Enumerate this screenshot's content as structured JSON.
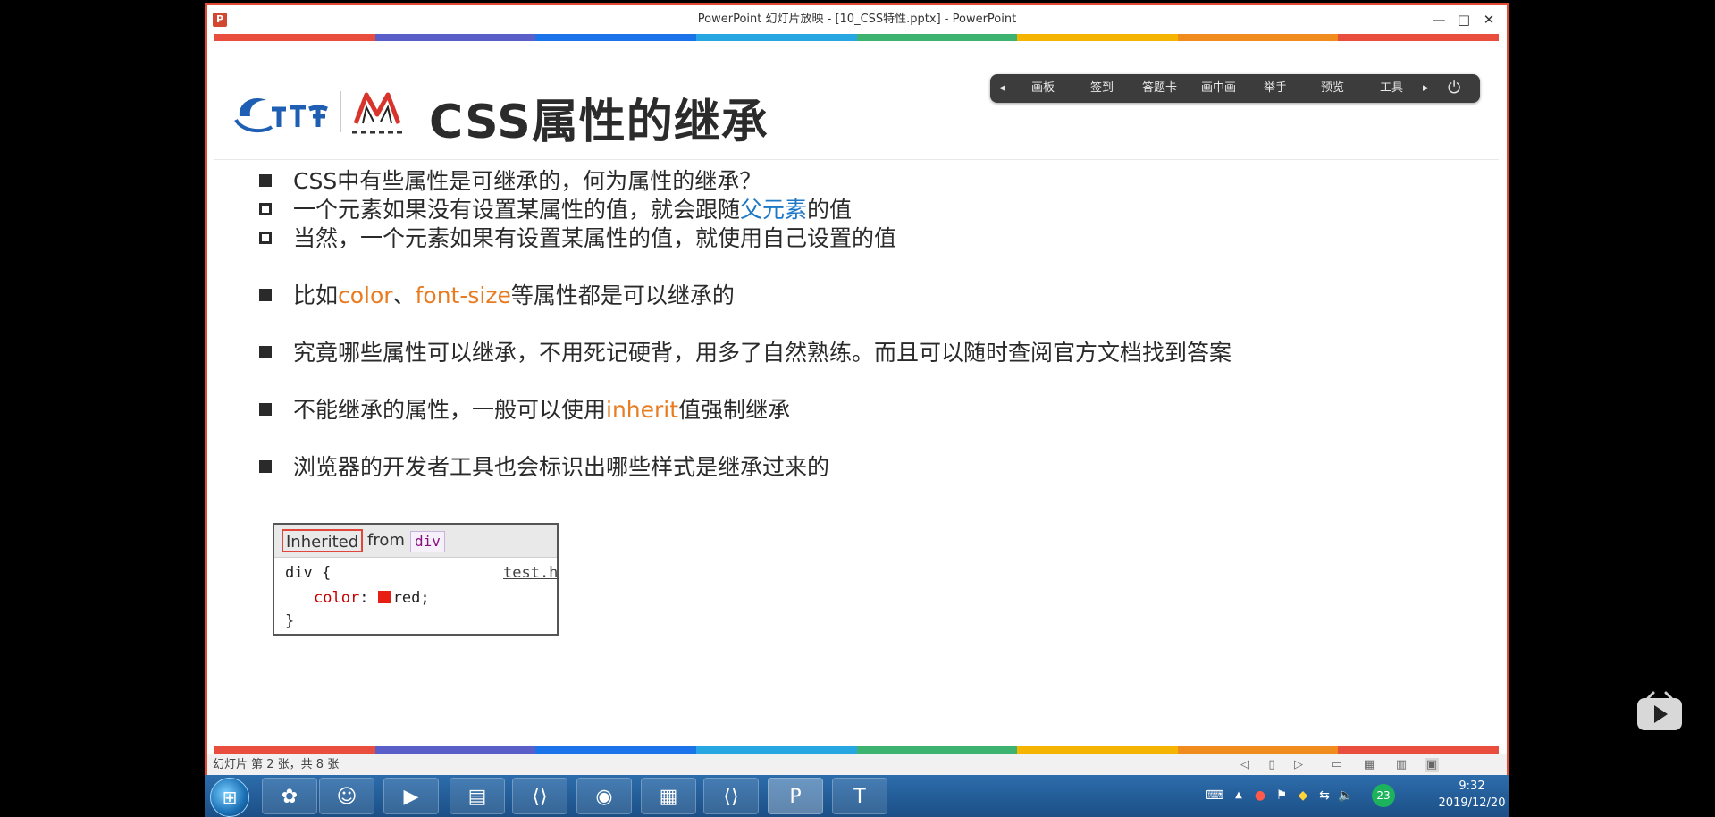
{
  "window": {
    "title": "PowerPoint 幻灯片放映 - [10_CSS特性.pptx] - PowerPoint",
    "app_icon": "P",
    "minimize": "—",
    "maximize": "□",
    "close": "✕"
  },
  "slide": {
    "title": "CSS属性的继承",
    "stripe_colors": [
      "#e84d3d",
      "#5a5ec8",
      "#1a73e8",
      "#27a7e2",
      "#3cb371",
      "#f4b400",
      "#f08c1e",
      "#e84d3d"
    ],
    "bullets": [
      {
        "type": "filled",
        "parts": [
          {
            "text": "CSS中有些属性是可继承的，何为属性的继承？"
          }
        ]
      },
      {
        "type": "hollow",
        "parts": [
          {
            "text": "一个元素如果没有设置某属性的值，就会跟随"
          },
          {
            "text": "父元素",
            "color": "blue"
          },
          {
            "text": "的值"
          }
        ]
      },
      {
        "type": "hollow",
        "parts": [
          {
            "text": "当然，一个元素如果有设置某属性的值，就使用自己设置的值"
          }
        ]
      },
      {
        "type": "filled",
        "parts": [
          {
            "text": "比如"
          },
          {
            "text": "color",
            "color": "orange"
          },
          {
            "text": "、"
          },
          {
            "text": "font-size",
            "color": "orange"
          },
          {
            "text": "等属性都是可以继承的"
          }
        ]
      },
      {
        "type": "filled",
        "parts": [
          {
            "text": "究竟哪些属性可以继承，不用死记硬背，用多了自然熟练。而且可以随时查阅官方文档找到答案"
          }
        ]
      },
      {
        "type": "filled",
        "parts": [
          {
            "text": "不能继承的属性，一般可以使用"
          },
          {
            "text": "inherit",
            "color": "orange"
          },
          {
            "text": "值强制继承"
          }
        ]
      },
      {
        "type": "filled",
        "parts": [
          {
            "text": "浏览器的开发者工具也会标识出哪些样式是继承过来的"
          }
        ]
      }
    ],
    "devtools": {
      "inherited": "Inherited",
      "from": "from",
      "tag": "div",
      "selector": "div {",
      "source": "test.h",
      "property": "color",
      "colon": ":",
      "value": "red;",
      "close": "}"
    }
  },
  "toolbar": {
    "items": [
      "画板",
      "签到",
      "答题卡",
      "画中画",
      "举手",
      "预览",
      "工具"
    ],
    "collapse": "◂",
    "expand": "▸",
    "power": "⏻"
  },
  "statusbar": {
    "text": "幻灯片 第 2 张，共 8 张"
  },
  "taskbar": {
    "clock_time": "9:32",
    "clock_date": "2019/12/20",
    "badge": "23",
    "tray_arrow": "▲"
  }
}
